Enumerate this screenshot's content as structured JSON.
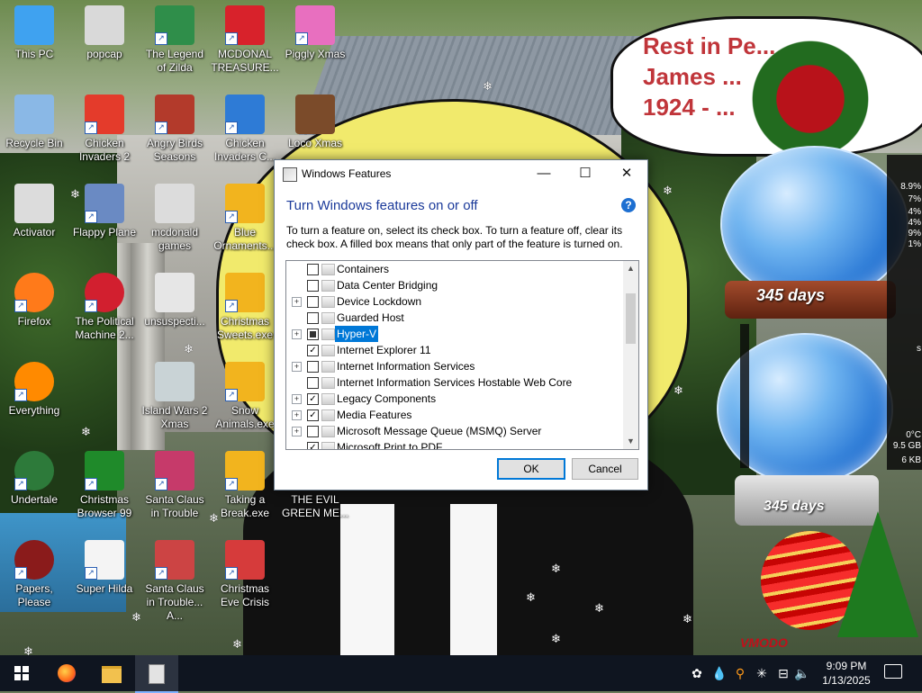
{
  "desktop": {
    "icons": [
      {
        "label": "This PC",
        "color": "#3fa2f0"
      },
      {
        "label": "popcap",
        "color": "#d9d9d9"
      },
      {
        "label": "The Legend of Zilda",
        "color": "#2f8e4a"
      },
      {
        "label": "MCDONAL TREASURE...",
        "color": "#d8222b"
      },
      {
        "label": "Piggly Xmas",
        "color": "#e86fbf"
      },
      {
        "label": "Recycle Bin",
        "color": "#8ab8e6"
      },
      {
        "label": "Chicken Invaders 2",
        "color": "#e43b2b"
      },
      {
        "label": "Angry Birds Seasons",
        "color": "#b33a2b"
      },
      {
        "label": "Chicken Invaders C...",
        "color": "#2e7bd6"
      },
      {
        "label": "Loco Xmas",
        "color": "#7b4b2a"
      },
      {
        "label": "Activator",
        "color": "#dcdcdc"
      },
      {
        "label": "Flappy Plane",
        "color": "#6a8ac3"
      },
      {
        "label": "mcdonald games",
        "color": "#dcdcdc"
      },
      {
        "label": "Blue Ornaments...",
        "color": "#f2b41e"
      },
      {
        "label": "Firefox",
        "color": "#ff7a1a"
      },
      {
        "label": "The Political Machine 2...",
        "color": "#d21f2f"
      },
      {
        "label": "unsuspecti...",
        "color": "#e6e6e6"
      },
      {
        "label": "Christmas Sweets.exe",
        "color": "#f2b41e"
      },
      {
        "label": "Everything",
        "color": "#ff8a00"
      },
      {
        "label": "Island Wars 2 Xmas",
        "color": "#c9d3d6"
      },
      {
        "label": "Snow Animals.exe",
        "color": "#f2b41e"
      },
      {
        "label": "Undertale",
        "color": "#2d7a3a"
      },
      {
        "label": "Christmas Browser 99",
        "color": "#1f8a2a"
      },
      {
        "label": "Santa Claus in Trouble",
        "color": "#c63a6a"
      },
      {
        "label": "Taking a Break.exe",
        "color": "#f2b41e"
      },
      {
        "label": "THE EVIL GREEN ME...",
        "color": "#2f8f3a"
      },
      {
        "label": "Papers, Please",
        "color": "#8a1b1b"
      },
      {
        "label": "Super Hilda",
        "color": "#f4f4f4"
      },
      {
        "label": "Santa Claus in Trouble... A...",
        "color": "#c44"
      },
      {
        "label": "Christmas Eve Crisis",
        "color": "#d63b3b"
      }
    ]
  },
  "wallpaper": {
    "rip_text": "Rest in Pe...\nJames ...\n1924 - ...",
    "days_top": "345 days",
    "days_bottom": "345 days",
    "brand": "VMODO",
    "sysmon": [
      "8.9%",
      "7%",
      "4%",
      "4%",
      "9%",
      "1%",
      "s",
      "0°C",
      "9.5 GB",
      "6 KB"
    ]
  },
  "dialog": {
    "title": "Windows Features",
    "heading": "Turn Windows features on or off",
    "help": "?",
    "description": "To turn a feature on, select its check box. To turn a feature off, clear its check box. A filled box means that only part of the feature is turned on.",
    "features": [
      {
        "name": "Containers",
        "expander": false,
        "state": "off"
      },
      {
        "name": "Data Center Bridging",
        "expander": false,
        "state": "off"
      },
      {
        "name": "Device Lockdown",
        "expander": true,
        "state": "off"
      },
      {
        "name": "Guarded Host",
        "expander": false,
        "state": "off"
      },
      {
        "name": "Hyper-V",
        "expander": true,
        "state": "partial",
        "selected": true
      },
      {
        "name": "Internet Explorer 11",
        "expander": false,
        "state": "on"
      },
      {
        "name": "Internet Information Services",
        "expander": true,
        "state": "off"
      },
      {
        "name": "Internet Information Services Hostable Web Core",
        "expander": false,
        "state": "off"
      },
      {
        "name": "Legacy Components",
        "expander": true,
        "state": "on"
      },
      {
        "name": "Media Features",
        "expander": true,
        "state": "on"
      },
      {
        "name": "Microsoft Message Queue (MSMQ) Server",
        "expander": true,
        "state": "off"
      },
      {
        "name": "Microsoft Print to PDF",
        "expander": false,
        "state": "on"
      }
    ],
    "ok_label": "OK",
    "cancel_label": "Cancel"
  },
  "taskbar": {
    "time": "9:09 PM",
    "date": "1/13/2025"
  }
}
